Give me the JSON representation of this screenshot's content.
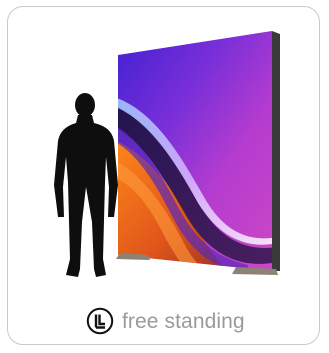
{
  "feature": {
    "icon": "free-standing-icon",
    "label": "free standing"
  },
  "colors": {
    "card_border": "#c9c9c9",
    "caption_text": "#9a9a9a",
    "silhouette": "#0e0e0e",
    "frame_edge": "#3a3a3a",
    "feet": "#8c8275"
  }
}
